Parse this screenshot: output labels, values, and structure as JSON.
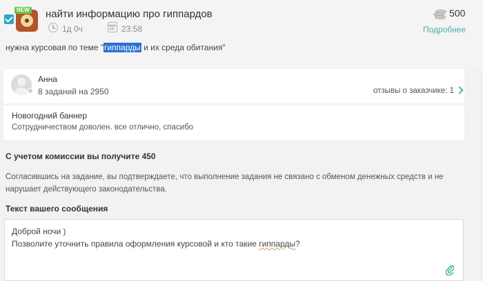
{
  "task": {
    "new_badge": "NEW",
    "title": "найти информацию про гиппардов",
    "time_ago": "1д 0ч",
    "time": "23:58",
    "price": "500",
    "details_link": "Подробнее",
    "description_before": "нужна курсовая по теме \"",
    "description_highlight": "гиппарды",
    "description_after": " и их среда обитания\""
  },
  "customer": {
    "name": "Анна",
    "stats": "8 заданий на 2950",
    "reviews": "отзывы о заказчике: 1"
  },
  "review": {
    "title": "Новогодний баннер",
    "text": "Сотрудничеством доволен. все отлично, спасибо"
  },
  "commission": {
    "text": "С учетом комиссии вы получите 450"
  },
  "agreement": {
    "text": "Согласившись на задание, вы подтверждаете, что выполнение задания не связано с обменом денежных средств и не нарушает действующего законодательства."
  },
  "message": {
    "label": "Текст вашего сообщения",
    "line1": "Доброй ночи )",
    "line2_before": "Позволите уточнить правила оформления курсовой и кто такие ",
    "line2_underlined": "гиппарды",
    "line2_after": "?"
  },
  "colors": {
    "accent": "#4ab0a3",
    "checkbox": "#2fa7c6",
    "new_badge": "#6cc34b",
    "highlight": "#2b6fd6"
  },
  "icons": [
    "checkbox-icon",
    "clock-icon",
    "calendar-icon",
    "coins-icon",
    "chevron-right-icon",
    "paperclip-icon"
  ]
}
